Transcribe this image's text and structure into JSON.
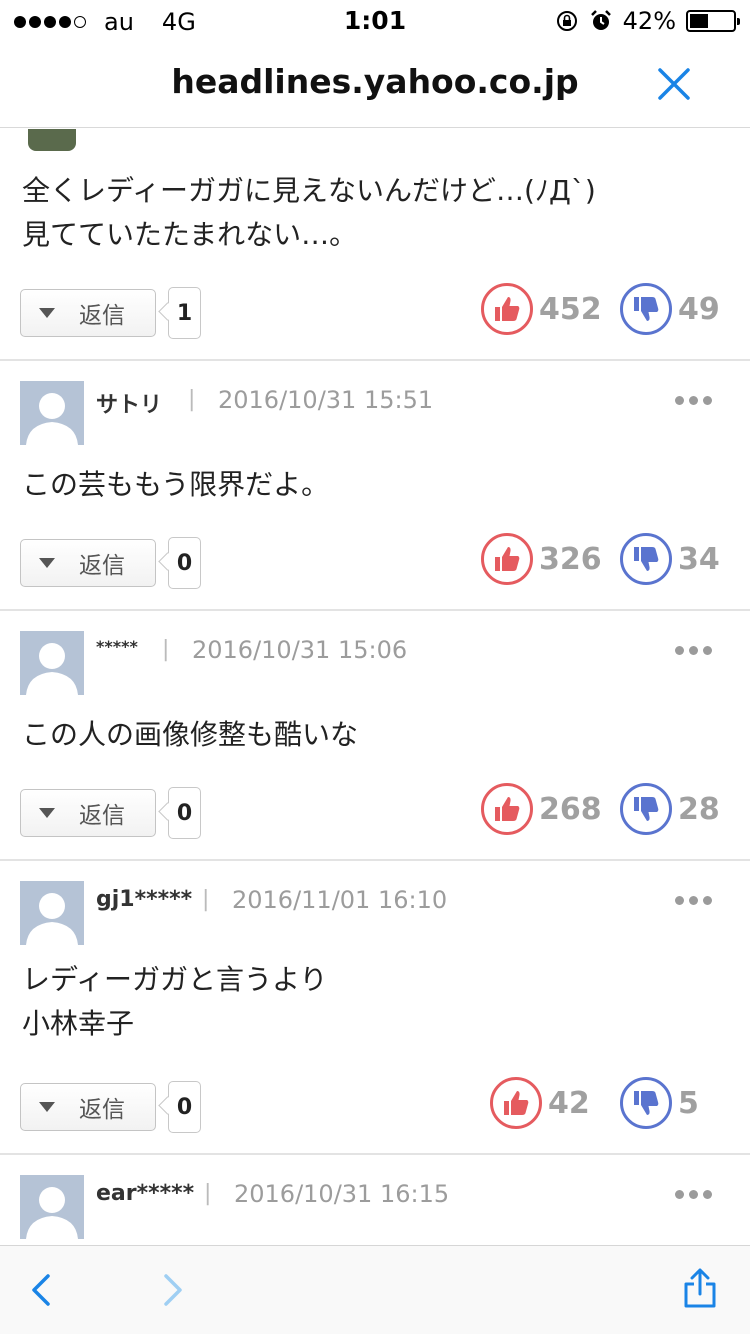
{
  "status": {
    "carrier": "au",
    "network": "4G",
    "time": "1:01",
    "battery": "42%",
    "battery_level": 0.42
  },
  "url": "headlines.yahoo.co.jp",
  "reply_label": "返信",
  "first_comment": {
    "lines": [
      "全くレディーガガに見えないんだけど…(ﾉД`)",
      "見てていたたまれない…。"
    ],
    "replies": "1",
    "likes": "452",
    "dislikes": "49"
  },
  "comments": [
    {
      "user": "サトリ",
      "date": "2016/10/31 15:51",
      "lines": [
        "この芸ももう限界だよ。"
      ],
      "replies": "0",
      "likes": "326",
      "dislikes": "34"
    },
    {
      "user": "*****",
      "date": "2016/10/31 15:06",
      "lines": [
        "この人の画像修整も酷いな"
      ],
      "replies": "0",
      "likes": "268",
      "dislikes": "28"
    },
    {
      "user": "gj1*****",
      "date": "2016/11/01 16:10",
      "lines": [
        "レディーガガと言うより",
        "小林幸子"
      ],
      "replies": "0",
      "likes": "42",
      "dislikes": "5"
    },
    {
      "user": "ear*****",
      "date": "2016/10/31 16:15"
    }
  ],
  "colors": {
    "like": "#e55b5f",
    "dislike": "#5a74cf",
    "ios_blue": "#1a84e6"
  },
  "icons": {
    "close": "close-icon",
    "back": "back-arrow-icon",
    "forward": "forward-arrow-icon",
    "share": "share-icon",
    "like": "thumbs-up-icon",
    "dislike": "thumbs-down-icon",
    "more": "more-dots-icon"
  }
}
